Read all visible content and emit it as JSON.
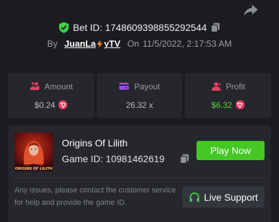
{
  "bet": {
    "label": "Bet ID:",
    "id": "1748609398855292544"
  },
  "byline": {
    "by": "By",
    "username_part1": "JuanLa",
    "username_part2": "yTV",
    "on": "On",
    "datetime": "11/5/2022, 2:17:53 AM"
  },
  "stats": [
    {
      "label": "Amount",
      "value": "$0.24",
      "icon": "coins-icon",
      "currency_icon": "tron-icon"
    },
    {
      "label": "Payout",
      "value": "26.32 x",
      "icon": "wallet-icon"
    },
    {
      "label": "Profit",
      "value": "$6.32",
      "icon": "profit-icon",
      "currency_icon": "tron-icon"
    }
  ],
  "game": {
    "title": "Origins Of Lilith",
    "id_text": "Game ID: 10981462619",
    "thumb_text": "ORIGINS OF LILITH",
    "play_label": "Play Now"
  },
  "support": {
    "help_text": "Any issues, please contact the customer service for help and provide the game ID.",
    "button_label": "Live Support"
  },
  "colors": {
    "background": "#1b1c20",
    "card": "#25272c",
    "accent_green": "#44c825",
    "profit_green": "#4fd43a",
    "icon_pink": "#e83e5f",
    "icon_purple": "#a34bea",
    "shield_green": "#3ecf4a",
    "bolt_orange": "#ff8a1e"
  }
}
